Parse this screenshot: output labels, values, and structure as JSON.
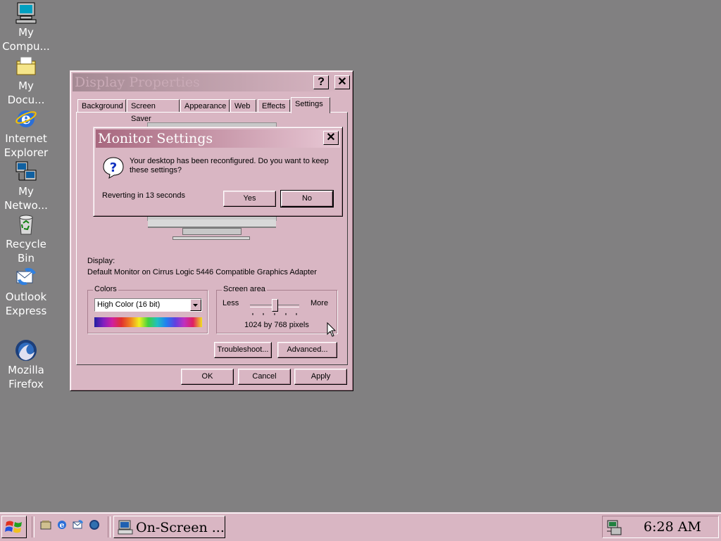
{
  "desktop": {
    "icons": [
      {
        "label": "My\nCompu..."
      },
      {
        "label": "My\nDocu..."
      },
      {
        "label": "Internet\nExplorer"
      },
      {
        "label": "My\nNetwo..."
      },
      {
        "label": "Recycle\nBin"
      },
      {
        "label": "Outlook\nExpress"
      },
      {
        "label": "Mozilla\nFirefox"
      }
    ]
  },
  "display_properties": {
    "title": "Display Properties",
    "help_button": "?",
    "close_button": "✕",
    "tabs": [
      {
        "label": "Background"
      },
      {
        "label": "Screen Saver"
      },
      {
        "label": "Appearance"
      },
      {
        "label": "Web"
      },
      {
        "label": "Effects"
      },
      {
        "label": "Settings",
        "active": true
      }
    ],
    "display_label": "Display:",
    "display_value": "Default Monitor on Cirrus Logic 5446 Compatible Graphics Adapter",
    "colors": {
      "group_label": "Colors",
      "selected": "High Color (16 bit)"
    },
    "screen_area": {
      "group_label": "Screen area",
      "less": "Less",
      "more": "More",
      "value": "1024 by 768 pixels",
      "slider_position": 0.5
    },
    "troubleshoot_button": "Troubleshoot...",
    "advanced_button": "Advanced...",
    "ok_button": "OK",
    "cancel_button": "Cancel",
    "apply_button": "Apply"
  },
  "monitor_settings": {
    "title": "Monitor Settings",
    "close_button": "✕",
    "message": "Your desktop has been reconfigured.  Do you want to keep these settings?",
    "countdown": "Reverting in 13 seconds",
    "yes_button": "Yes",
    "no_button": "No"
  },
  "taskbar": {
    "task_label": "On-Screen ...",
    "clock": "6:28 AM"
  },
  "colors": {
    "desktop": "#818081",
    "face": "#d9b6c3",
    "dialog_title_gradient_start": "#a8687f",
    "dialog_title_gradient_end": "#e8c8d5"
  }
}
